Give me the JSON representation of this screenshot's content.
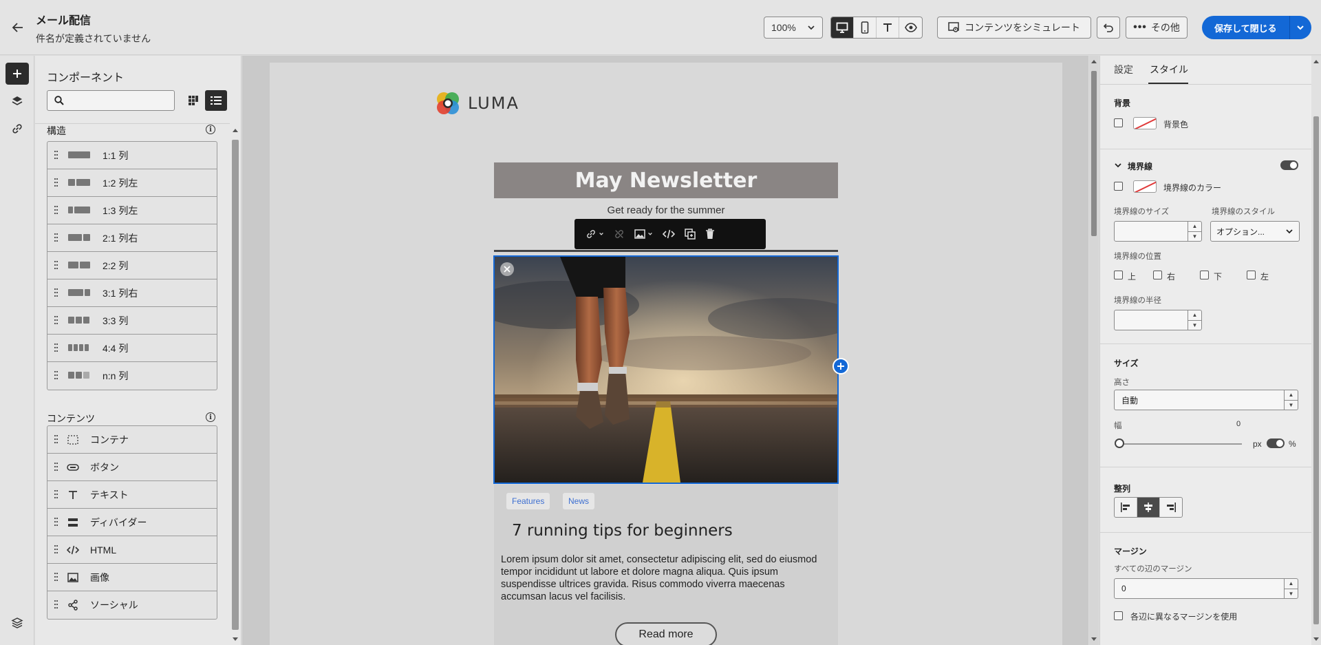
{
  "header": {
    "title": "メール配信",
    "subtitle": "件名が定義されていません",
    "zoom": "100%",
    "simulate_label": "コンテンツをシミュレート",
    "more_label": "その他",
    "save_label": "保存して閉じる"
  },
  "components": {
    "title": "コンポーネント",
    "search_placeholder": "",
    "structure_heading": "構造",
    "structure_items": [
      {
        "label": "1:1 列"
      },
      {
        "label": "1:2 列左"
      },
      {
        "label": "1:3 列左"
      },
      {
        "label": "2:1 列右"
      },
      {
        "label": "2:2 列"
      },
      {
        "label": "3:1 列右"
      },
      {
        "label": "3:3 列"
      },
      {
        "label": "4:4 列"
      },
      {
        "label": "n:n 列"
      }
    ],
    "content_heading": "コンテンツ",
    "content_items": [
      {
        "label": "コンテナ",
        "icon": "container-icon"
      },
      {
        "label": "ボタン",
        "icon": "button-icon"
      },
      {
        "label": "テキスト",
        "icon": "text-icon"
      },
      {
        "label": "ディバイダー",
        "icon": "divider-icon"
      },
      {
        "label": "HTML",
        "icon": "code-icon"
      },
      {
        "label": "画像",
        "icon": "image-icon"
      },
      {
        "label": "ソーシャル",
        "icon": "share-icon"
      }
    ]
  },
  "email": {
    "logo_text": "LUMA",
    "banner_title": "May Newsletter",
    "banner_subtitle": "Get ready for the summer",
    "tags": [
      "Features",
      "News"
    ],
    "article_title": "7 running tips for beginners",
    "article_body": "Lorem ipsum dolor sit amet, consectetur adipiscing elit, sed do eiusmod tempor incididunt ut labore et dolore magna aliqua. Quis ipsum suspendisse ultrices gravida. Risus commodo viverra maecenas accumsan lacus vel facilisis.",
    "read_more": "Read more"
  },
  "properties": {
    "tabs": [
      "設定",
      "スタイル"
    ],
    "active_tab": "スタイル",
    "background": {
      "heading": "背景",
      "color_label": "背景色"
    },
    "border": {
      "heading": "境界線",
      "enabled": true,
      "color_label": "境界線のカラー",
      "size_label": "境界線のサイズ",
      "size_value": "",
      "style_label": "境界線のスタイル",
      "style_value": "オプション...",
      "position_label": "境界線の位置",
      "positions": [
        "上",
        "右",
        "下",
        "左"
      ],
      "radius_label": "境界線の半径",
      "radius_value": ""
    },
    "size": {
      "heading": "サイズ",
      "height_label": "高さ",
      "height_value": "自動",
      "width_label": "幅",
      "width_value": "0",
      "unit_px": "px",
      "unit_percent": "%"
    },
    "alignment": {
      "heading": "整列",
      "active": "center"
    },
    "margin": {
      "heading": "マージン",
      "all_label": "すべての辺のマージン",
      "all_value": "0",
      "different_label": "各辺に異なるマージンを使用"
    }
  },
  "colors": {
    "accent": "#1368d6",
    "dark": "#2c2c2c"
  }
}
